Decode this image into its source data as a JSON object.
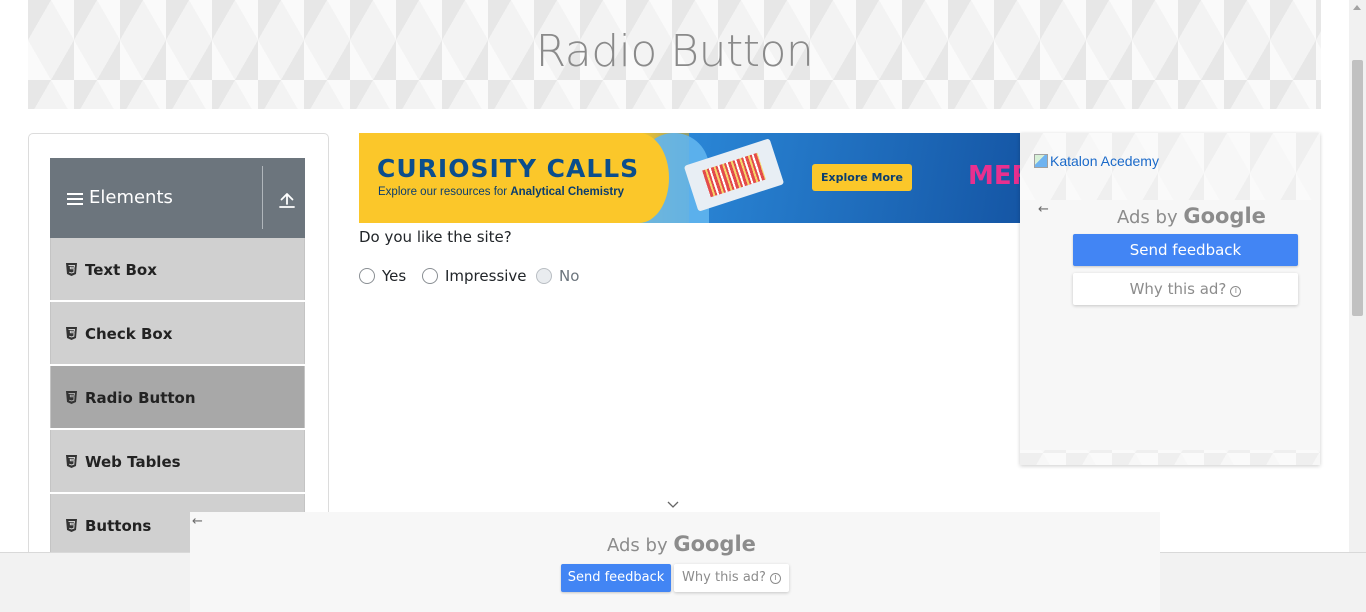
{
  "page": {
    "title": "Radio Button"
  },
  "sidebar": {
    "header_label": "Elements",
    "items": [
      {
        "label": "Text Box",
        "active": false
      },
      {
        "label": "Check Box",
        "active": false
      },
      {
        "label": "Radio Button",
        "active": true
      },
      {
        "label": "Web Tables",
        "active": false
      },
      {
        "label": "Buttons",
        "active": false
      }
    ]
  },
  "ad_banner": {
    "headline": "CURIOSITY CALLS",
    "sub_prefix": "Explore our resources for ",
    "sub_emphasis": "Analytical Chemistry",
    "cta": "Explore More",
    "brand": "MER"
  },
  "main": {
    "question": "Do you like the site?",
    "options": [
      {
        "label": "Yes",
        "disabled": false
      },
      {
        "label": "Impressive",
        "disabled": false
      },
      {
        "label": "No",
        "disabled": true
      }
    ]
  },
  "right_ad": {
    "image_alt": "Katalon Acedemy",
    "ads_by": "Ads by",
    "google": "Google",
    "send_feedback": "Send feedback",
    "why_this_ad": "Why this ad?",
    "info_glyph": "i"
  },
  "bottom_ad": {
    "ads_by": "Ads by",
    "google": "Google",
    "send_feedback": "Send feedback",
    "why_this_ad": "Why this ad?",
    "info_glyph": "i"
  },
  "colors": {
    "header_bg": "#6c757d",
    "menu_bg": "#d0d0d0",
    "menu_active_bg": "#a8a8a8",
    "feedback_button": "#4285f4",
    "link": "#1b6ac9"
  }
}
